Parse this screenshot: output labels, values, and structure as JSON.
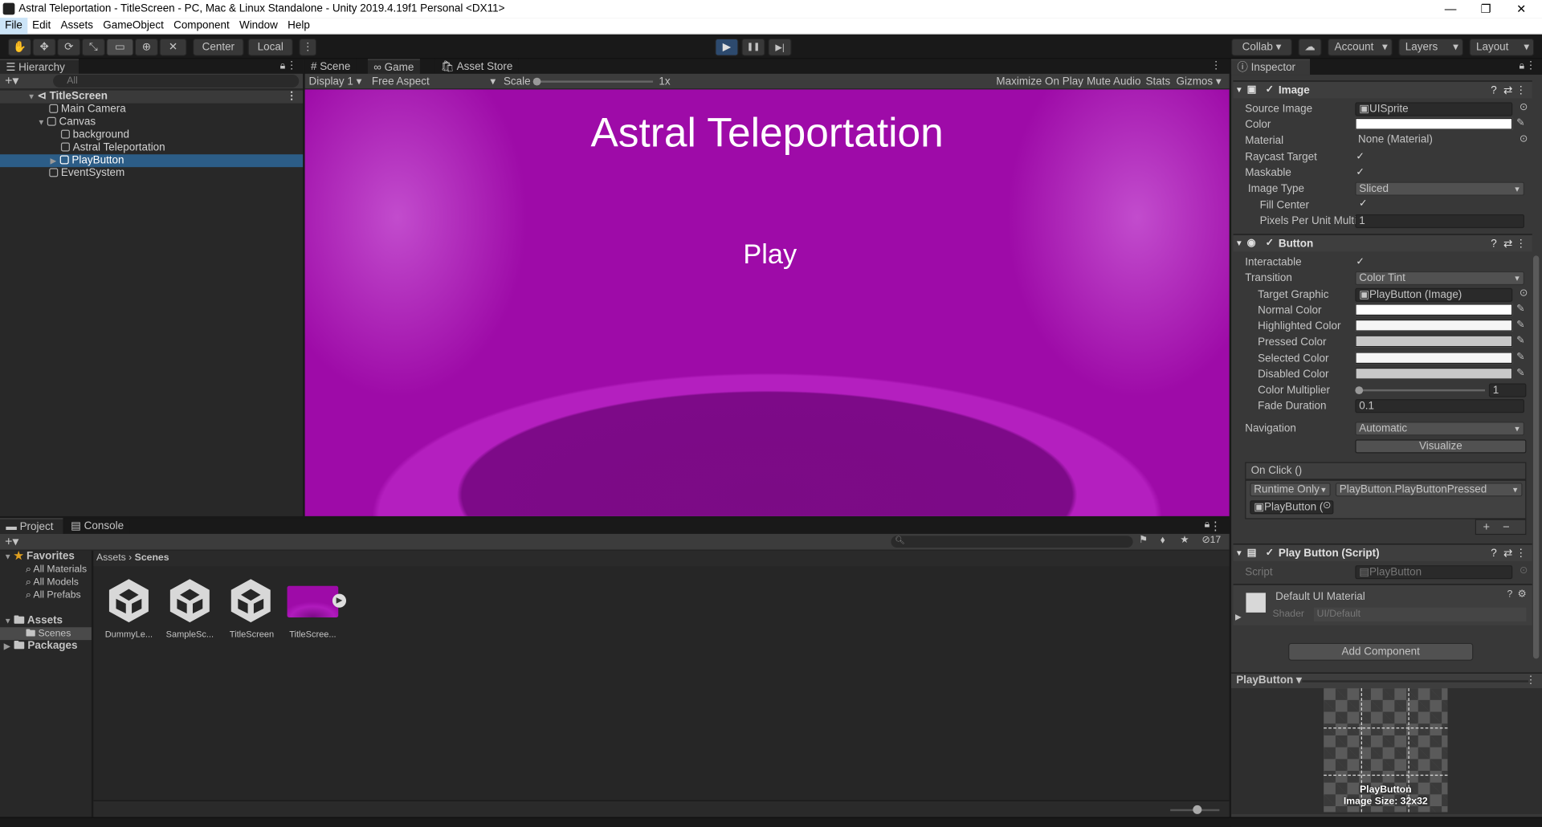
{
  "window": {
    "title": "Astral Teleportation - TitleScreen - PC, Mac & Linux Standalone - Unity 2019.4.19f1 Personal <DX11>",
    "min": "—",
    "max": "❐",
    "close": "✕"
  },
  "menu": [
    "File",
    "Edit",
    "Assets",
    "GameObject",
    "Component",
    "Window",
    "Help"
  ],
  "toolbar": {
    "center": "Center",
    "local": "Local",
    "collab": "Collab ▾",
    "account": "Account",
    "layers": "Layers",
    "layout": "Layout",
    "play_icon": "▶",
    "pause_icon": "❚❚",
    "step_icon": "▶|"
  },
  "hierarchy": {
    "tab": "Hierarchy",
    "search_placeholder": "All",
    "items": [
      "TitleScreen",
      "Main Camera",
      "Canvas",
      "background",
      "Astral Teleportation",
      "PlayButton",
      "EventSystem"
    ]
  },
  "views": {
    "scene_tab": "Scene",
    "game_tab": "Game",
    "asset_tab": "Asset Store",
    "display": "Display 1",
    "aspect": "Free Aspect",
    "scale_label": "Scale",
    "scale_value": "1x",
    "maximize": "Maximize On Play",
    "mute": "Mute Audio",
    "stats": "Stats",
    "gizmos": "Gizmos"
  },
  "game": {
    "title": "Astral Teleportation",
    "play": "Play"
  },
  "inspector": {
    "tab": "Inspector",
    "image": {
      "header": "Image",
      "source_label": "Source Image",
      "source_value": "UISprite",
      "color_label": "Color",
      "material_label": "Material",
      "material_value": "None (Material)",
      "raycast_label": "Raycast Target",
      "maskable_label": "Maskable",
      "image_type_label": "Image Type",
      "image_type_value": "Sliced",
      "fill_center_label": "Fill Center",
      "ppu_label": "Pixels Per Unit Multip",
      "ppu_value": "1"
    },
    "button": {
      "header": "Button",
      "interactable_label": "Interactable",
      "transition_label": "Transition",
      "transition_value": "Color Tint",
      "target_label": "Target Graphic",
      "target_value": "PlayButton (Image)",
      "normal_label": "Normal Color",
      "highlighted_label": "Highlighted Color",
      "pressed_label": "Pressed Color",
      "selected_label": "Selected Color",
      "disabled_label": "Disabled Color",
      "multiplier_label": "Color Multiplier",
      "multiplier_value": "1",
      "fade_label": "Fade Duration",
      "fade_value": "0.1",
      "navigation_label": "Navigation",
      "navigation_value": "Automatic",
      "visualize": "Visualize",
      "onclick_label": "On Click ()",
      "runtime_value": "Runtime Only",
      "function_value": "PlayButton.PlayButtonPressed",
      "object_value": "PlayButton (",
      "plus": "+",
      "minus": "−"
    },
    "script": {
      "header": "Play Button (Script)",
      "script_label": "Script",
      "script_value": "PlayButton"
    },
    "material": {
      "name": "Default UI Material",
      "shader_label": "Shader",
      "shader_value": "UI/Default"
    },
    "add_component": "Add Component",
    "preview": {
      "dropdown": "PlayButton ▾",
      "name": "PlayButton",
      "size": "Image Size: 32x32"
    }
  },
  "project": {
    "tab": "Project",
    "console_tab": "Console",
    "favorites": "Favorites",
    "fav_items": [
      "All Materials",
      "All Models",
      "All Prefabs"
    ],
    "assets": "Assets",
    "scenes": "Scenes",
    "packages": "Packages",
    "breadcrumb_root": "Assets",
    "breadcrumb_current": "Scenes",
    "hidden_count": "17",
    "files": [
      "DummyLe...",
      "SampleSc...",
      "TitleScreen",
      "TitleScree..."
    ]
  },
  "colors": {
    "accent": "#2c5d87",
    "game_bg": "#9e0ba8"
  }
}
